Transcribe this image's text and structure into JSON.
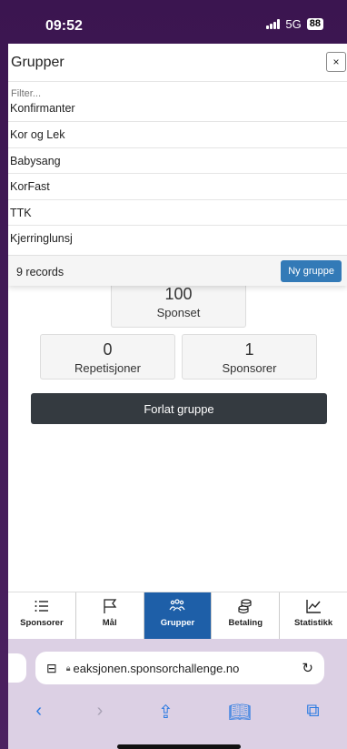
{
  "status_bar": {
    "time": "09:52",
    "network": "5G",
    "battery": "88"
  },
  "groups_panel": {
    "title": "Grupper",
    "close_label": "×",
    "filter_placeholder": "Filter...",
    "items": [
      "Konfirmanter",
      "Kor og Lek",
      "Babysang",
      "KorFast",
      "TTK",
      "Kjerringlunsj"
    ],
    "records_text": "9 records",
    "new_group_label": "Ny gruppe"
  },
  "stats": {
    "sponset_value": "100",
    "sponset_label": "Sponset",
    "repetisjoner_value": "0",
    "repetisjoner_label": "Repetisjoner",
    "sponsorer_value": "1",
    "sponsorer_label": "Sponsorer"
  },
  "leave_group_label": "Forlat gruppe",
  "tabs": [
    {
      "label": "Sponsorer",
      "icon": "list-icon"
    },
    {
      "label": "Mål",
      "icon": "flag-icon"
    },
    {
      "label": "Grupper",
      "icon": "group-icon",
      "active": true
    },
    {
      "label": "Betaling",
      "icon": "coins-icon"
    },
    {
      "label": "Statistikk",
      "icon": "chart-icon"
    }
  ],
  "browser": {
    "url": "eaksjonen.sponsorchallenge.no"
  },
  "colors": {
    "active_tab": "#1e5fa8",
    "primary_button": "#337ab7",
    "dark_button": "#343a40"
  }
}
